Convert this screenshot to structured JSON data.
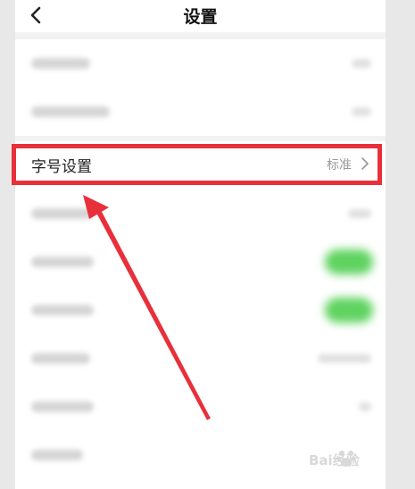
{
  "nav": {
    "title": "设置",
    "back_icon": "chevron-left-icon"
  },
  "highlighted_row": {
    "label": "字号设置",
    "value": "标准",
    "chevron_icon": "chevron-right-icon"
  },
  "annotation": {
    "box_color": "#e8303b",
    "arrow_color": "#e8303b"
  },
  "toggle_color": "#5fd35f",
  "watermark": {
    "text": "Bai经验"
  }
}
